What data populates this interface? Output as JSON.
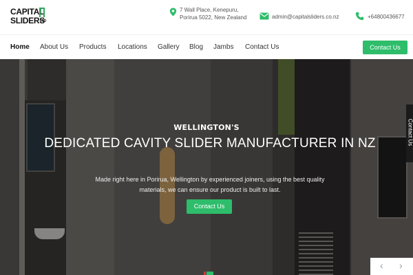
{
  "brand": {
    "logo_line1": "CAPITAL",
    "logo_line2": "SLIDERS",
    "logo_suffix": "LTD",
    "accent_color": "#2ebd6b"
  },
  "contact": {
    "address": "7 Wall Place, Kenepuru, Porirua 5022, New Zealand",
    "address_icon": "map-pin-icon",
    "email": "admin@capitalsliders.co.nz",
    "email_icon": "envelope-icon",
    "phone": "+64800436677",
    "phone_icon": "phone-icon"
  },
  "nav": {
    "items": [
      "Home",
      "About Us",
      "Products",
      "Locations",
      "Gallery",
      "Blog",
      "Jambs",
      "Contact Us"
    ],
    "active": "Home",
    "cta_label": "Contact Us"
  },
  "hero": {
    "kicker": "WELLINGTON'S",
    "title": "DEDICATED CAVITY SLIDER MANUFACTURER IN NZ",
    "subtitle": "Made right here in Porirua, Wellington by experienced joiners, using the best quality materials, we can ensure our product is built to last.",
    "cta_label": "Contact Us"
  },
  "side_tab": {
    "label": "Contact Us"
  },
  "slider": {
    "prev_icon": "chevron-left-icon",
    "next_icon": "chevron-right-icon"
  }
}
